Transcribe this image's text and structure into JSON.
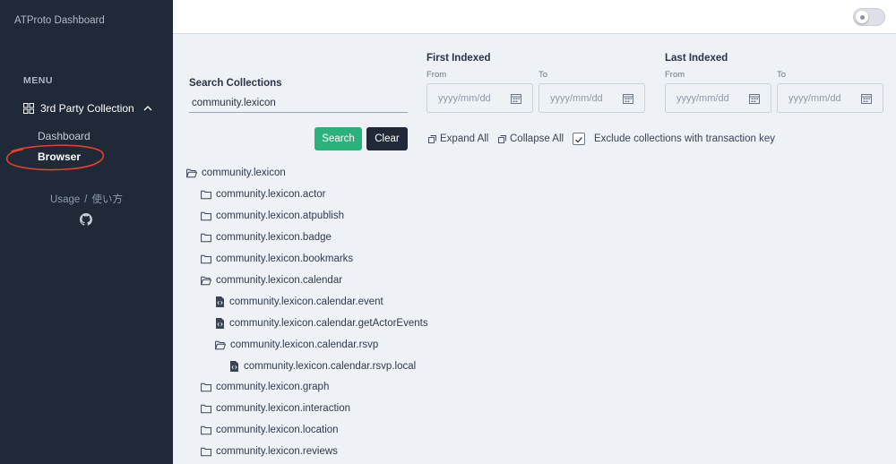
{
  "app_title": "ATProto Dashboard",
  "sidebar": {
    "menu_label": "MENU",
    "section_label": "3rd Party Collection",
    "items": [
      {
        "label": "Dashboard"
      },
      {
        "label": "Browser"
      }
    ],
    "usage_label": "Usage",
    "usage_separator": "/",
    "usage_jp_label": "使い方"
  },
  "search": {
    "label": "Search Collections",
    "value": "community.lexicon",
    "search_button": "Search",
    "clear_button": "Clear"
  },
  "first_indexed": {
    "title": "First Indexed",
    "from_label": "From",
    "to_label": "To",
    "from_placeholder": "yyyy/mm/dd",
    "to_placeholder": "yyyy/mm/dd"
  },
  "last_indexed": {
    "title": "Last Indexed",
    "from_label": "From",
    "to_label": "To",
    "from_placeholder": "yyyy/mm/dd",
    "to_placeholder": "yyyy/mm/dd"
  },
  "actions": {
    "expand_all": "Expand All",
    "collapse_all": "Collapse All",
    "exclude_label": "Exclude collections with transaction key",
    "exclude_checked": true
  },
  "tree": [
    {
      "label": "community.lexicon",
      "type": "folder-open",
      "depth": 0
    },
    {
      "label": "community.lexicon.actor",
      "type": "folder",
      "depth": 1
    },
    {
      "label": "community.lexicon.atpublish",
      "type": "folder",
      "depth": 1
    },
    {
      "label": "community.lexicon.badge",
      "type": "folder",
      "depth": 1
    },
    {
      "label": "community.lexicon.bookmarks",
      "type": "folder",
      "depth": 1
    },
    {
      "label": "community.lexicon.calendar",
      "type": "folder-open",
      "depth": 1
    },
    {
      "label": "community.lexicon.calendar.event",
      "type": "file",
      "depth": 2
    },
    {
      "label": "community.lexicon.calendar.getActorEvents",
      "type": "file",
      "depth": 2
    },
    {
      "label": "community.lexicon.calendar.rsvp",
      "type": "folder-open",
      "depth": 2
    },
    {
      "label": "community.lexicon.calendar.rsvp.local",
      "type": "file",
      "depth": 3
    },
    {
      "label": "community.lexicon.graph",
      "type": "folder",
      "depth": 1
    },
    {
      "label": "community.lexicon.interaction",
      "type": "folder",
      "depth": 1
    },
    {
      "label": "community.lexicon.location",
      "type": "folder",
      "depth": 1
    },
    {
      "label": "community.lexicon.reviews",
      "type": "folder",
      "depth": 1
    }
  ],
  "colors": {
    "sidebar_bg": "#1f2937",
    "content_bg": "#eef1f5",
    "search_button": "#2bb27a",
    "clear_button": "#1f2937",
    "annotation": "#e8412b"
  }
}
